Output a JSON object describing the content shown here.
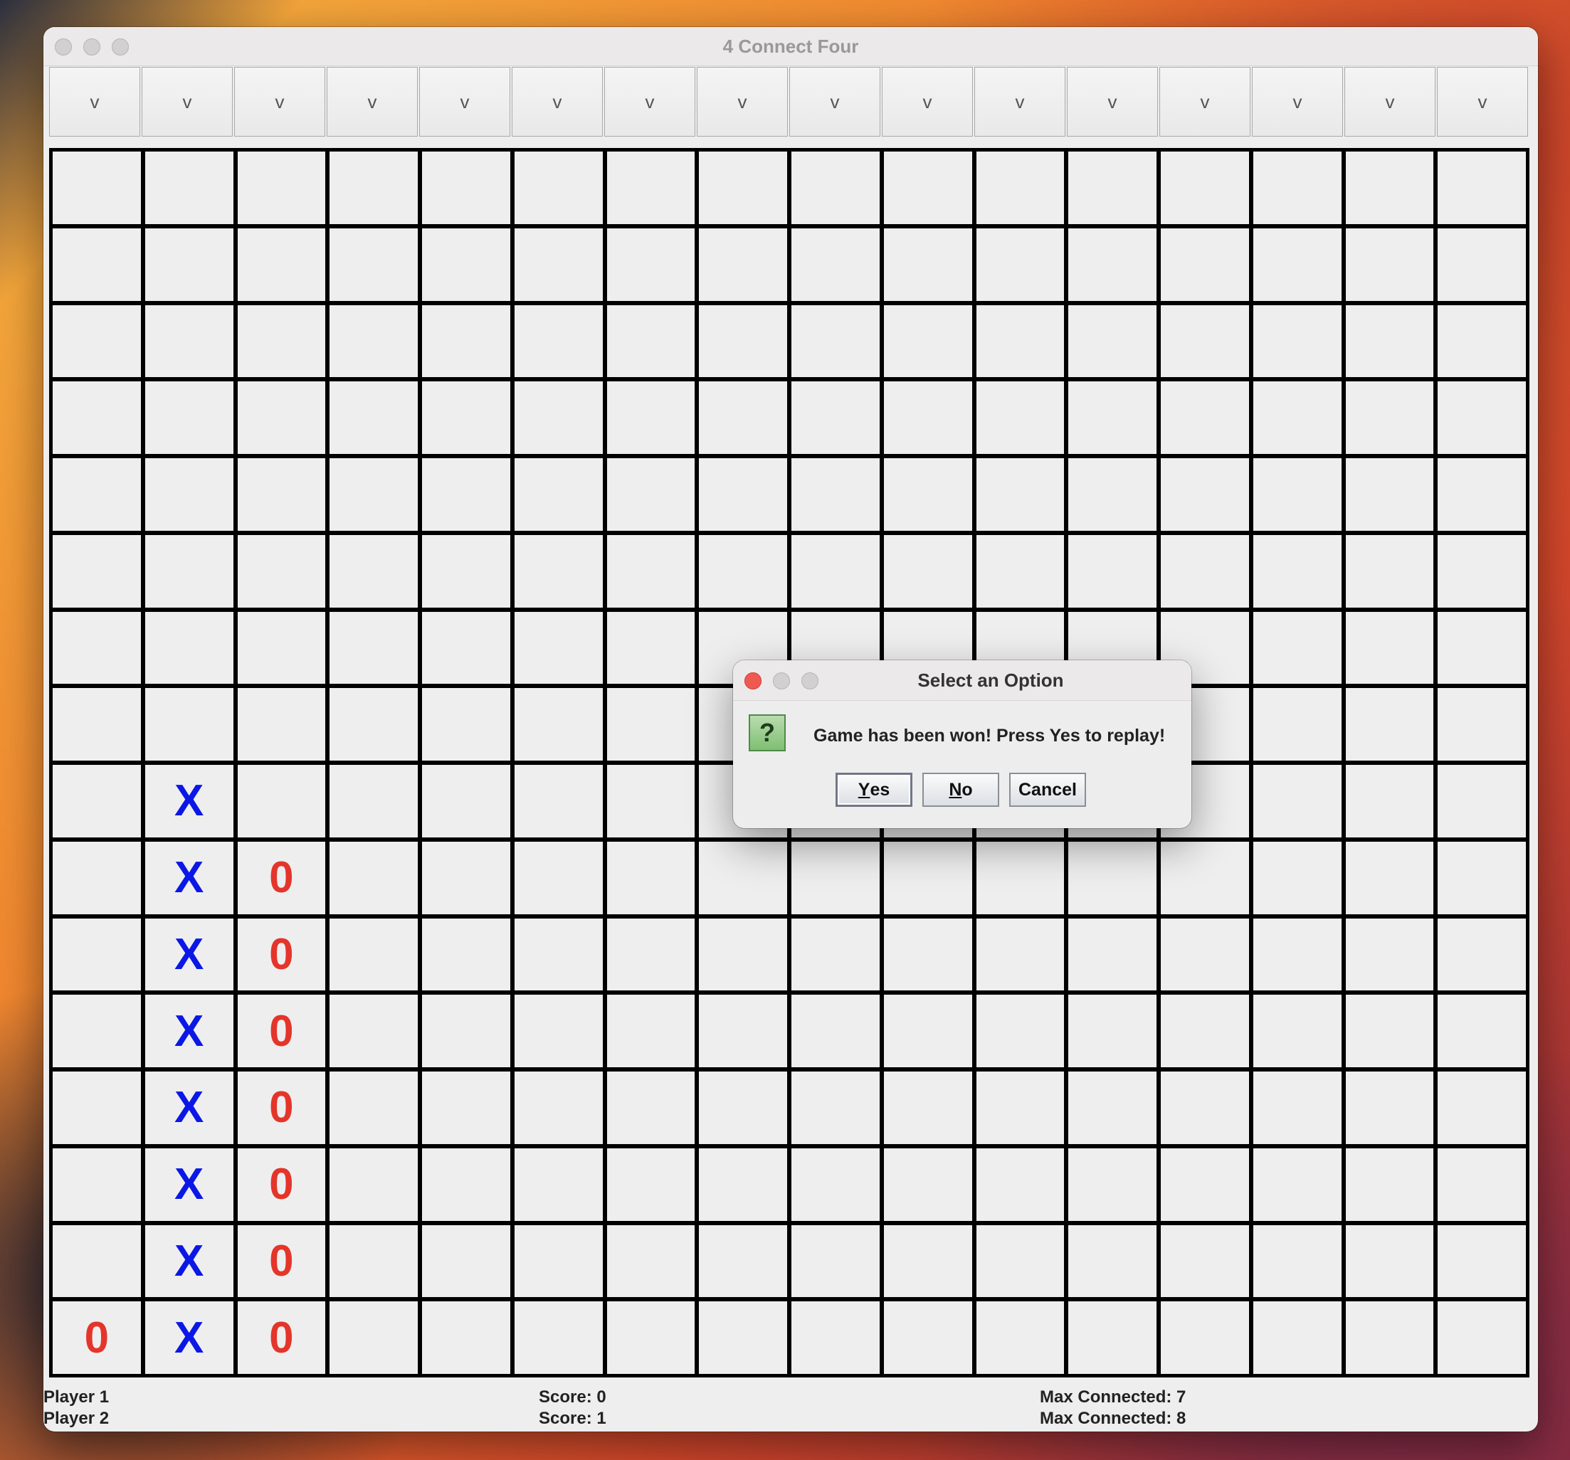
{
  "window": {
    "title": "4 Connect Four"
  },
  "drop_buttons": [
    "v",
    "v",
    "v",
    "v",
    "v",
    "v",
    "v",
    "v",
    "v",
    "v",
    "v",
    "v",
    "v",
    "v",
    "v",
    "v"
  ],
  "board": {
    "rows": 16,
    "cols": 16,
    "cells": [
      [
        "",
        "",
        "",
        "",
        "",
        "",
        "",
        "",
        "",
        "",
        "",
        "",
        "",
        "",
        "",
        ""
      ],
      [
        "",
        "",
        "",
        "",
        "",
        "",
        "",
        "",
        "",
        "",
        "",
        "",
        "",
        "",
        "",
        ""
      ],
      [
        "",
        "",
        "",
        "",
        "",
        "",
        "",
        "",
        "",
        "",
        "",
        "",
        "",
        "",
        "",
        ""
      ],
      [
        "",
        "",
        "",
        "",
        "",
        "",
        "",
        "",
        "",
        "",
        "",
        "",
        "",
        "",
        "",
        ""
      ],
      [
        "",
        "",
        "",
        "",
        "",
        "",
        "",
        "",
        "",
        "",
        "",
        "",
        "",
        "",
        "",
        ""
      ],
      [
        "",
        "",
        "",
        "",
        "",
        "",
        "",
        "",
        "",
        "",
        "",
        "",
        "",
        "",
        "",
        ""
      ],
      [
        "",
        "",
        "",
        "",
        "",
        "",
        "",
        "",
        "",
        "",
        "",
        "",
        "",
        "",
        "",
        ""
      ],
      [
        "",
        "",
        "",
        "",
        "",
        "",
        "",
        "",
        "",
        "",
        "",
        "",
        "",
        "",
        "",
        ""
      ],
      [
        "",
        "X",
        "",
        "",
        "",
        "",
        "",
        "",
        "",
        "",
        "",
        "",
        "",
        "",
        "",
        ""
      ],
      [
        "",
        "X",
        "0",
        "",
        "",
        "",
        "",
        "",
        "",
        "",
        "",
        "",
        "",
        "",
        "",
        ""
      ],
      [
        "",
        "X",
        "0",
        "",
        "",
        "",
        "",
        "",
        "",
        "",
        "",
        "",
        "",
        "",
        "",
        ""
      ],
      [
        "",
        "X",
        "0",
        "",
        "",
        "",
        "",
        "",
        "",
        "",
        "",
        "",
        "",
        "",
        "",
        ""
      ],
      [
        "",
        "X",
        "0",
        "",
        "",
        "",
        "",
        "",
        "",
        "",
        "",
        "",
        "",
        "",
        "",
        ""
      ],
      [
        "",
        "X",
        "0",
        "",
        "",
        "",
        "",
        "",
        "",
        "",
        "",
        "",
        "",
        "",
        "",
        ""
      ],
      [
        "",
        "X",
        "0",
        "",
        "",
        "",
        "",
        "",
        "",
        "",
        "",
        "",
        "",
        "",
        "",
        ""
      ],
      [
        "0",
        "X",
        "0",
        "",
        "",
        "",
        "",
        "",
        "",
        "",
        "",
        "",
        "",
        "",
        "",
        ""
      ]
    ],
    "colors": {
      "X": "#0a17e6",
      "0": "#e4352b"
    }
  },
  "players": [
    {
      "name": "Player 1",
      "score": "Score: 0",
      "max": "Max Connected: 7"
    },
    {
      "name": "Player 2",
      "score": "Score: 1",
      "max": "Max Connected: 8"
    }
  ],
  "dialog": {
    "title": "Select an Option",
    "icon": "question-icon",
    "message": "Game has been won! Press Yes to replay!",
    "buttons": {
      "yes": {
        "mnemonic": "Y",
        "rest": "es"
      },
      "no": {
        "mnemonic": "N",
        "rest": "o"
      },
      "cancel": "Cancel"
    }
  }
}
